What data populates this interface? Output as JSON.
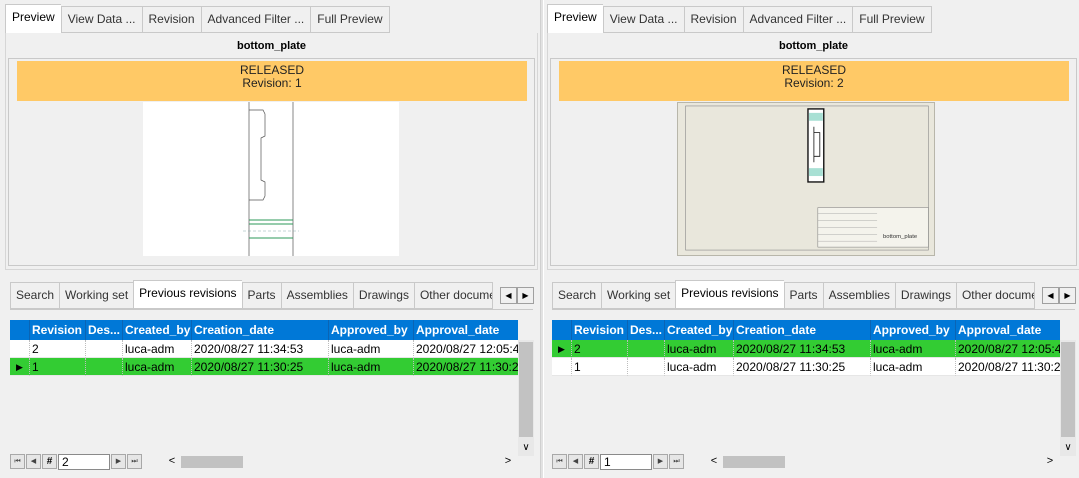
{
  "panels": [
    {
      "top_tabs": [
        "Preview",
        "View Data ...",
        "Revision",
        "Advanced Filter ...",
        "Full Preview"
      ],
      "active_top_tab": 0,
      "title": "bottom_plate",
      "status": "RELEASED",
      "revision_label": "Revision: 1",
      "bottom_tabs": [
        "Search",
        "Working set",
        "Previous revisions",
        "Parts",
        "Assemblies",
        "Drawings",
        "Other documents"
      ],
      "active_bottom_tab": 2,
      "columns": [
        "Revision",
        "Description",
        "Created_by",
        "Creation_date",
        "Approved_by",
        "Approval_date"
      ],
      "columns_visible": [
        "Revision",
        "Des...",
        "Created_by",
        "Creation_date",
        "Approved_by",
        "Approval_date"
      ],
      "rows": [
        {
          "revision": "2",
          "description": "",
          "created_by": "luca-adm",
          "creation_date": "2020/08/27 11:34:53",
          "approved_by": "luca-adm",
          "approval_date": "2020/08/27 12:05:4",
          "selected": false
        },
        {
          "revision": "1",
          "description": "",
          "created_by": "luca-adm",
          "creation_date": "2020/08/27 11:30:25",
          "approved_by": "luca-adm",
          "approval_date": "2020/08/27 11:30:2",
          "selected": true
        }
      ],
      "nav": {
        "page": "2",
        "hash": "#"
      }
    },
    {
      "top_tabs": [
        "Preview",
        "View Data ...",
        "Revision",
        "Advanced Filter ...",
        "Full Preview"
      ],
      "active_top_tab": 0,
      "title": "bottom_plate",
      "status": "RELEASED",
      "revision_label": "Revision: 2",
      "bottom_tabs": [
        "Search",
        "Working set",
        "Previous revisions",
        "Parts",
        "Assemblies",
        "Drawings",
        "Other documents"
      ],
      "active_bottom_tab": 2,
      "columns": [
        "Revision",
        "Description",
        "Created_by",
        "Creation_date",
        "Approved_by",
        "Approval_date"
      ],
      "columns_visible": [
        "Revision",
        "Des...",
        "Created_by",
        "Creation_date",
        "Approved_by",
        "Approval_date"
      ],
      "rows": [
        {
          "revision": "2",
          "description": "",
          "created_by": "luca-adm",
          "creation_date": "2020/08/27 11:34:53",
          "approved_by": "luca-adm",
          "approval_date": "2020/08/27 12:05:4",
          "selected": true
        },
        {
          "revision": "1",
          "description": "",
          "created_by": "luca-adm",
          "creation_date": "2020/08/27 11:30:25",
          "approved_by": "luca-adm",
          "approval_date": "2020/08/27 11:30:2",
          "selected": false
        }
      ],
      "nav": {
        "page": "1",
        "hash": "#"
      }
    }
  ],
  "drawing_label": "bottom_plate",
  "colors": {
    "status_banner": "#ffc966",
    "header": "#0078d7",
    "selected_row": "#33cc33"
  },
  "icons": {
    "scroll_left": "triangle-left",
    "scroll_right": "triangle-right",
    "row_pointer": "triangle-right",
    "first": "first-icon",
    "prev": "prev-icon",
    "next": "next-icon",
    "last": "last-icon"
  }
}
